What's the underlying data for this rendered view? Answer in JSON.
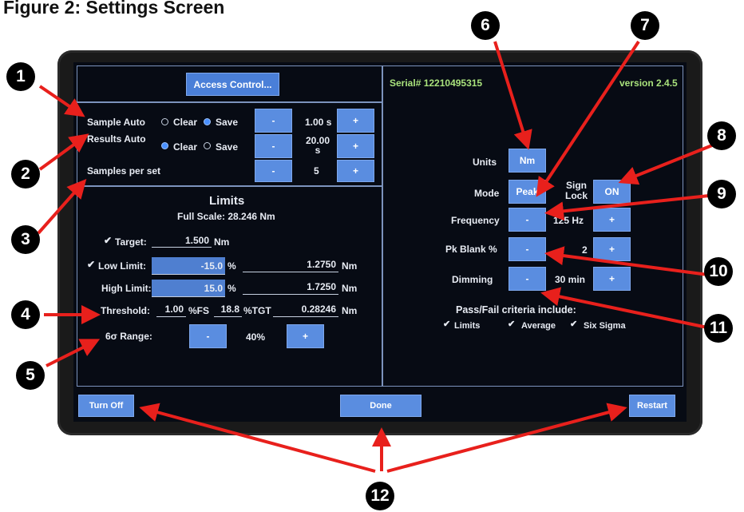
{
  "figure_title": "Figure 2: Settings Screen",
  "header": {
    "access_control": "Access Control...",
    "serial": "Serial# 12210495315",
    "version": "version 2.4.5"
  },
  "sample_auto": {
    "label": "Sample Auto",
    "clear": "Clear",
    "save": "Save",
    "selected": "Save",
    "minus": "-",
    "value": "1.00 s",
    "plus": "+"
  },
  "results_auto": {
    "label": "Results Auto",
    "clear": "Clear",
    "save": "Save",
    "selected": "Clear",
    "minus": "-",
    "value": "20.00 s",
    "plus": "+"
  },
  "samples_per_set": {
    "label": "Samples per set",
    "minus": "-",
    "value": "5",
    "plus": "+"
  },
  "limits": {
    "title": "Limits",
    "full_scale": "Full Scale: 28.246 Nm",
    "target_label": "Target:",
    "target_value": "1.500",
    "target_unit": "Nm",
    "target_checked": true,
    "low_label": "Low Limit:",
    "low_value": "-15.0",
    "low_pct": "%",
    "low_nm_value": "1.2750",
    "low_nm_unit": "Nm",
    "low_checked": true,
    "high_label": "High Limit:",
    "high_value": "15.0",
    "high_pct": "%",
    "high_nm_value": "1.7250",
    "high_nm_unit": "Nm",
    "threshold_label": "Threshold:",
    "threshold_fs": "1.00",
    "threshold_fs_unit": "%FS",
    "threshold_tgt": "18.8",
    "threshold_tgt_unit": "%TGT",
    "threshold_nm": "0.28246",
    "threshold_nm_unit": "Nm",
    "range_label": "6σ Range:",
    "range_minus": "-",
    "range_value": "40%",
    "range_plus": "+"
  },
  "right": {
    "units_label": "Units",
    "units_value": "Nm",
    "mode_label": "Mode",
    "mode_value": "Peak",
    "sign_lock_label": "Sign Lock",
    "sign_lock_value": "ON",
    "frequency_label": "Frequency",
    "frequency_minus": "-",
    "frequency_value": "125 Hz",
    "frequency_plus": "+",
    "pk_blank_label": "Pk Blank %",
    "pk_blank_minus": "-",
    "pk_blank_value": "2",
    "pk_blank_plus": "+",
    "dimming_label": "Dimming",
    "dimming_minus": "-",
    "dimming_value": "30 min",
    "dimming_plus": "+",
    "criteria_title": "Pass/Fail criteria include:",
    "criteria": [
      {
        "label": "Limits",
        "checked": true
      },
      {
        "label": "Average",
        "checked": true
      },
      {
        "label": "Six Sigma",
        "checked": true
      }
    ]
  },
  "footer": {
    "turn_off": "Turn Off",
    "done": "Done",
    "restart": "Restart"
  },
  "callouts": [
    "1",
    "2",
    "3",
    "4",
    "5",
    "6",
    "7",
    "8",
    "9",
    "10",
    "11",
    "12"
  ],
  "colors": {
    "screen_bg": "#070b14",
    "button": "#5a8de0",
    "accent_green": "#a9e27c",
    "arrow": "#e8201c"
  }
}
